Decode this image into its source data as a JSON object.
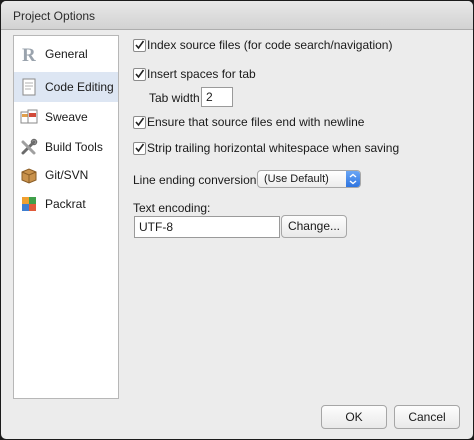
{
  "window": {
    "title": "Project Options"
  },
  "sidebar": {
    "items": [
      {
        "label": "General",
        "icon": "r-logo-icon"
      },
      {
        "label": "Code Editing",
        "icon": "document-icon",
        "selected": true
      },
      {
        "label": "Sweave",
        "icon": "sweave-icon"
      },
      {
        "label": "Build Tools",
        "icon": "tools-icon"
      },
      {
        "label": "Git/SVN",
        "icon": "package-box-icon"
      },
      {
        "label": "Packrat",
        "icon": "packrat-icon"
      }
    ]
  },
  "options": {
    "index_source": {
      "label": "Index source files (for code search/navigation)",
      "checked": true
    },
    "insert_spaces": {
      "label": "Insert spaces for tab",
      "checked": true
    },
    "tab_width": {
      "label": "Tab width",
      "value": "2"
    },
    "ensure_newline": {
      "label": "Ensure that source files end with newline",
      "checked": true
    },
    "strip_whitespace": {
      "label": "Strip trailing horizontal whitespace when saving",
      "checked": true
    },
    "line_ending": {
      "label": "Line ending conversion:",
      "value": "(Use Default)"
    },
    "text_encoding": {
      "label": "Text encoding:",
      "value": "UTF-8",
      "change_label": "Change..."
    }
  },
  "footer": {
    "ok_label": "OK",
    "cancel_label": "Cancel"
  },
  "colors": {
    "accent": "#2e74e0",
    "selected_row": "#dde6f3"
  }
}
